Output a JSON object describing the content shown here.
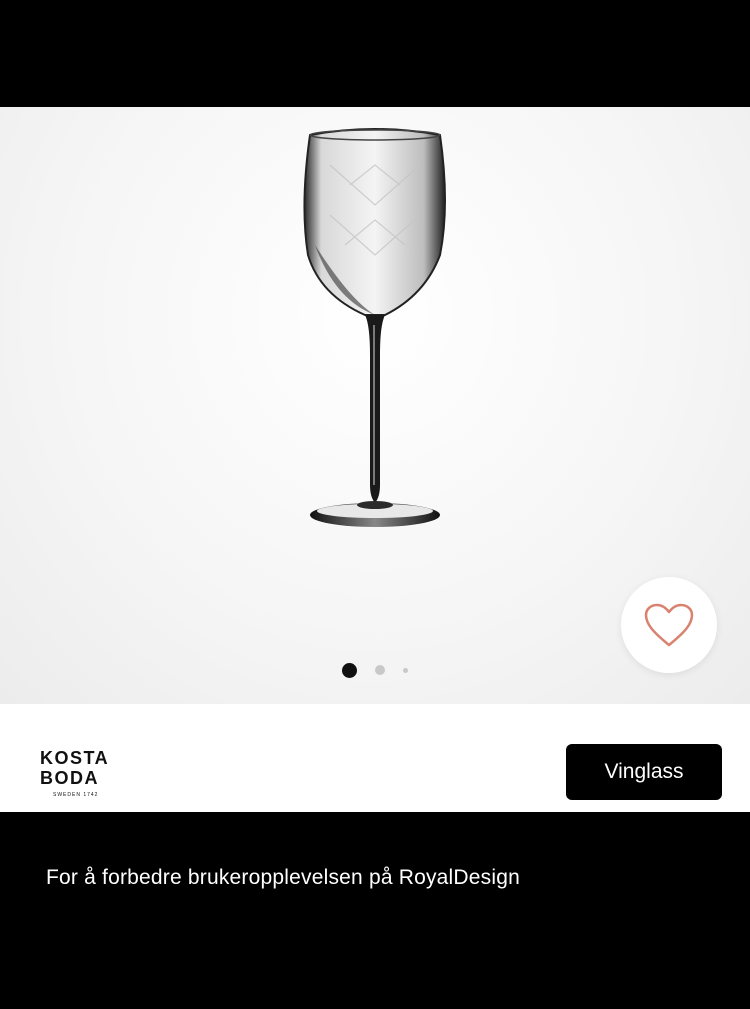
{
  "product": {
    "image_alt": "Kosta Boda Chateau wine glass",
    "favorite_icon": "heart-outline-icon",
    "carousel": {
      "total": 3,
      "active": 0
    }
  },
  "brand": {
    "line1": "KOSTA",
    "line2": "BODA",
    "tagline": "SWEDEN 1742"
  },
  "category_button": {
    "label": "Vinglass"
  },
  "cookie_banner": {
    "text": "For å forbedre brukeropplevelsen på RoyalDesign"
  },
  "colors": {
    "heart": "#d9826f",
    "accent": "#000000",
    "background": "#ffffff"
  }
}
